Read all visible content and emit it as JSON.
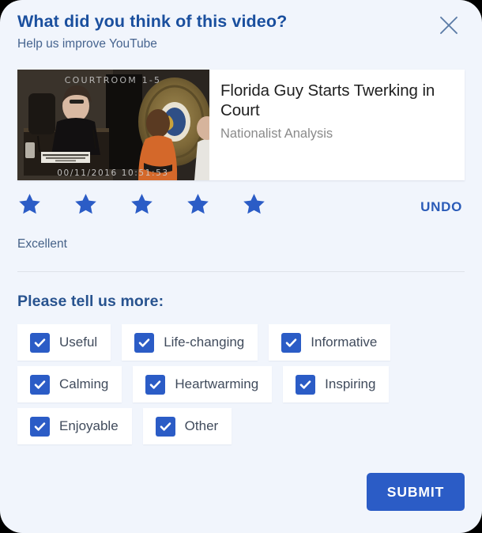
{
  "dialog": {
    "title": "What did you think of this video?",
    "subtitle": "Help us improve YouTube",
    "close_icon": "close-icon",
    "accent_color": "#2b5cc6",
    "title_color": "#1a4f9e",
    "background_color": "#f1f5fc"
  },
  "video": {
    "title": "Florida Guy Starts Twerking in Court",
    "channel": "Nationalist Analysis",
    "thumbnail": {
      "description": "Courtroom video still: judge at bench on the left, defendant in orange jumpsuit on the right in front of a sheriff's badge seal",
      "overlay_top_text": "COURTROOM 1-5",
      "overlay_timestamp": "00/11/2016 10:51:53"
    }
  },
  "rating": {
    "value": 5,
    "max": 5,
    "label": "Excellent",
    "star_icon": "star-icon",
    "undo_label": "UNDO"
  },
  "more": {
    "heading": "Please tell us more:",
    "check_icon": "check-icon",
    "options": [
      {
        "label": "Useful",
        "checked": true
      },
      {
        "label": "Life-changing",
        "checked": true
      },
      {
        "label": "Informative",
        "checked": true
      },
      {
        "label": "Calming",
        "checked": true
      },
      {
        "label": "Heartwarming",
        "checked": true
      },
      {
        "label": "Inspiring",
        "checked": true
      },
      {
        "label": "Enjoyable",
        "checked": true
      },
      {
        "label": "Other",
        "checked": true
      }
    ]
  },
  "footer": {
    "submit_label": "SUBMIT"
  }
}
